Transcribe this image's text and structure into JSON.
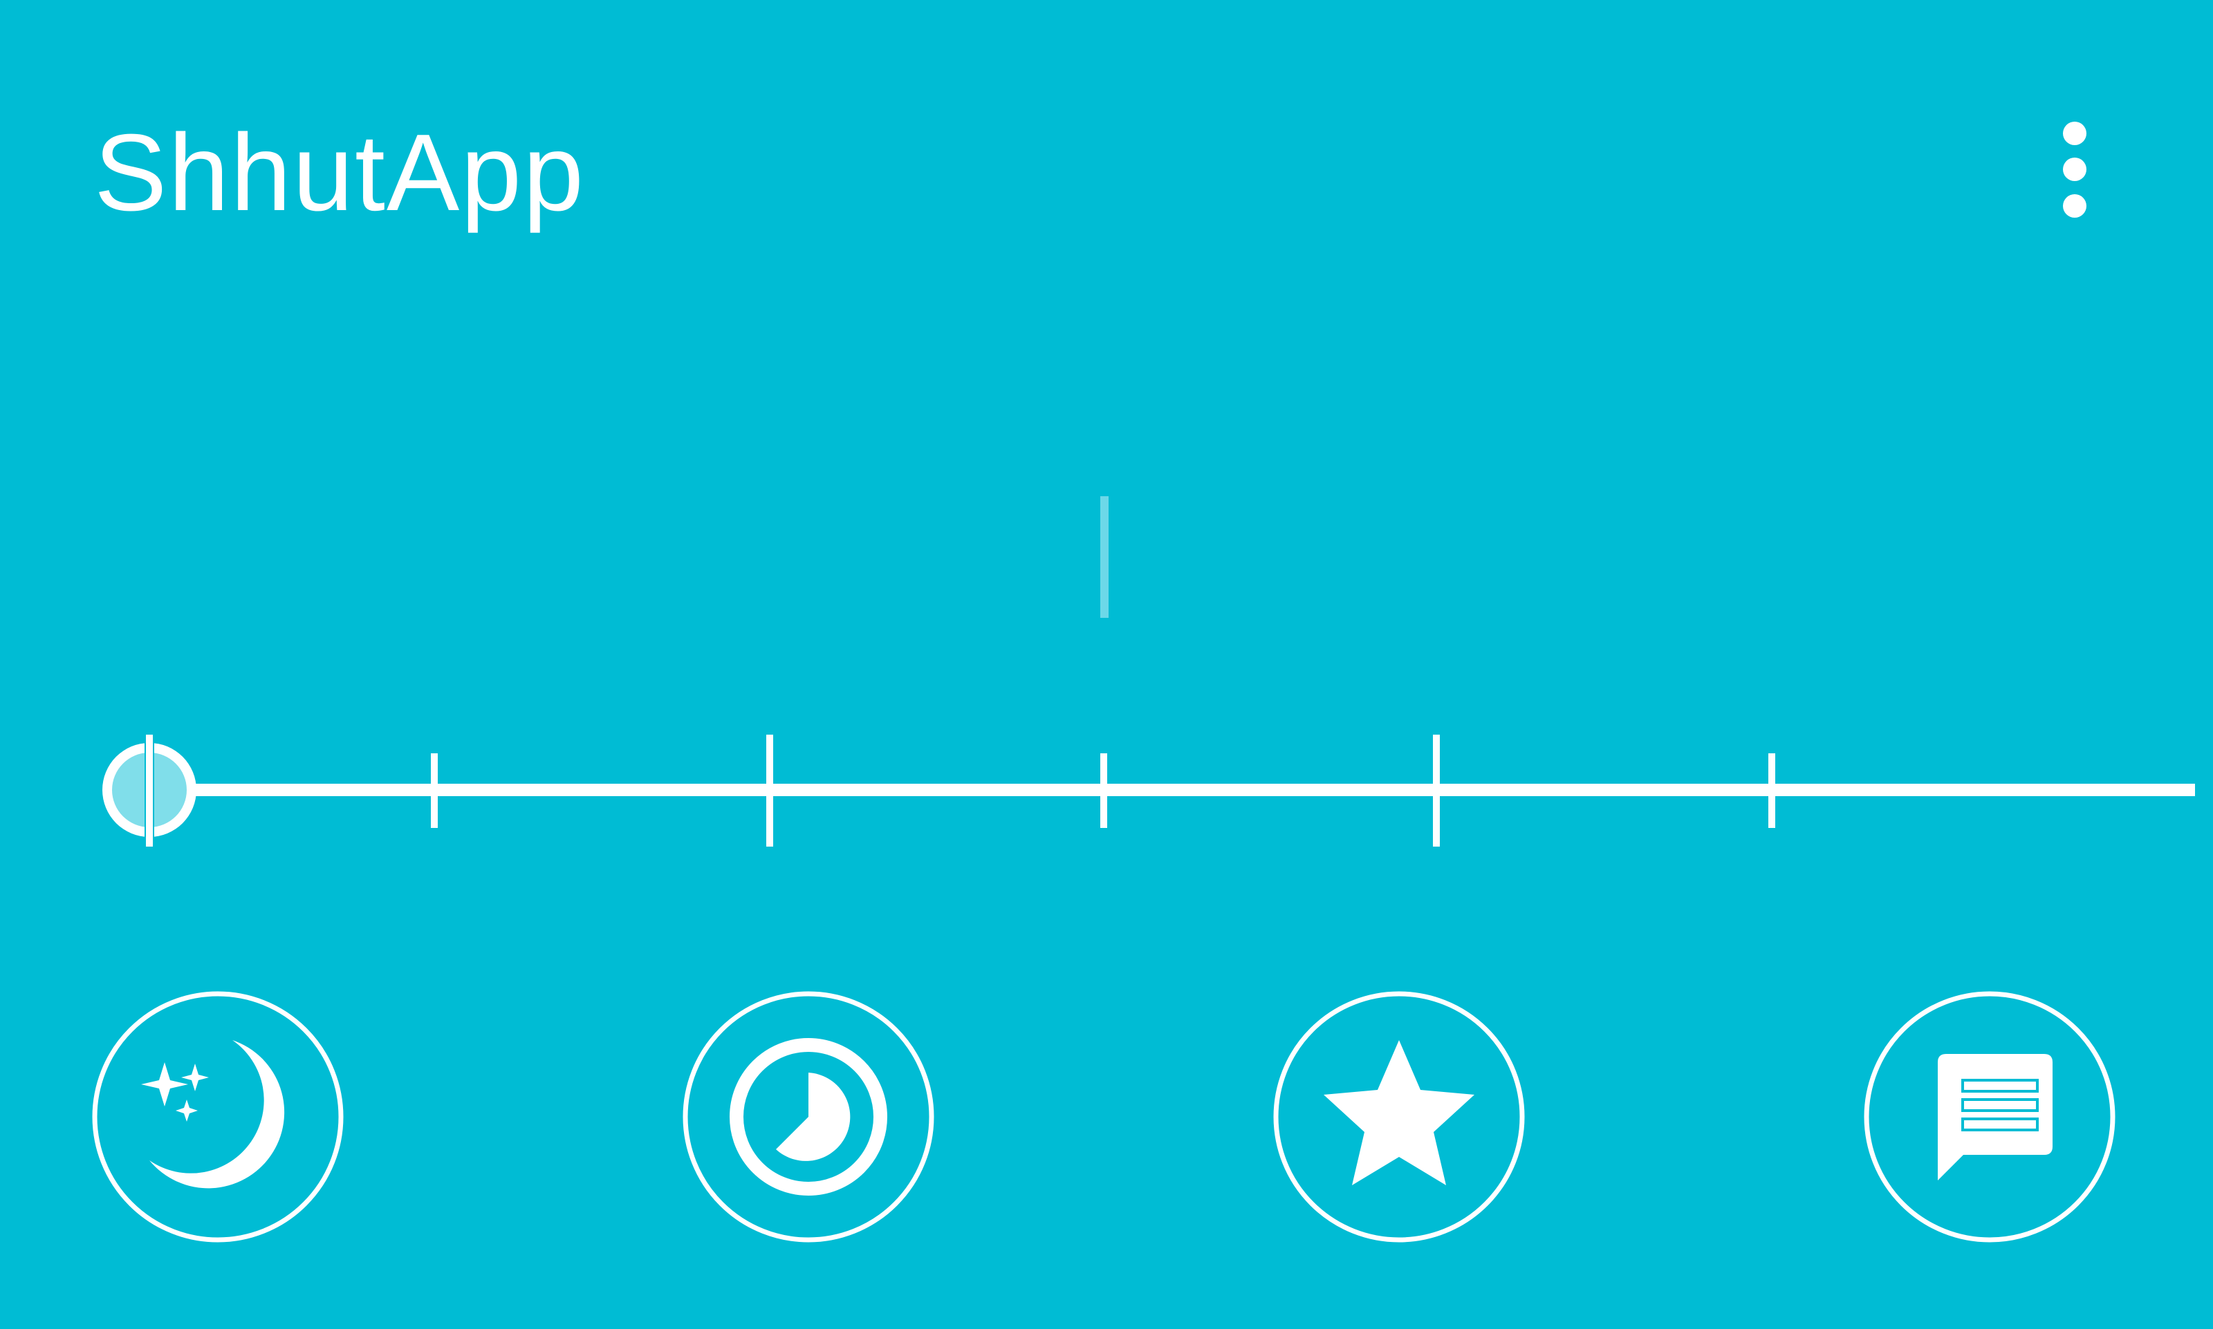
{
  "app": {
    "title": "ShhutApp"
  },
  "colors": {
    "background": "#00BCD4",
    "foreground": "#FFFFFF",
    "thumb_fill": "#80DEEA",
    "ghost_marker": "#7FDDEB"
  },
  "header": {
    "menu_icon": "more-vert-icon"
  },
  "slider": {
    "ticks": 7,
    "value": 0,
    "min": 0,
    "max": 6
  },
  "actions": [
    {
      "name": "sleep-mode-button",
      "icon": "moon-stars-icon"
    },
    {
      "name": "timer-button",
      "icon": "timer-icon"
    },
    {
      "name": "favorites-button",
      "icon": "star-icon"
    },
    {
      "name": "feedback-button",
      "icon": "message-icon"
    }
  ]
}
